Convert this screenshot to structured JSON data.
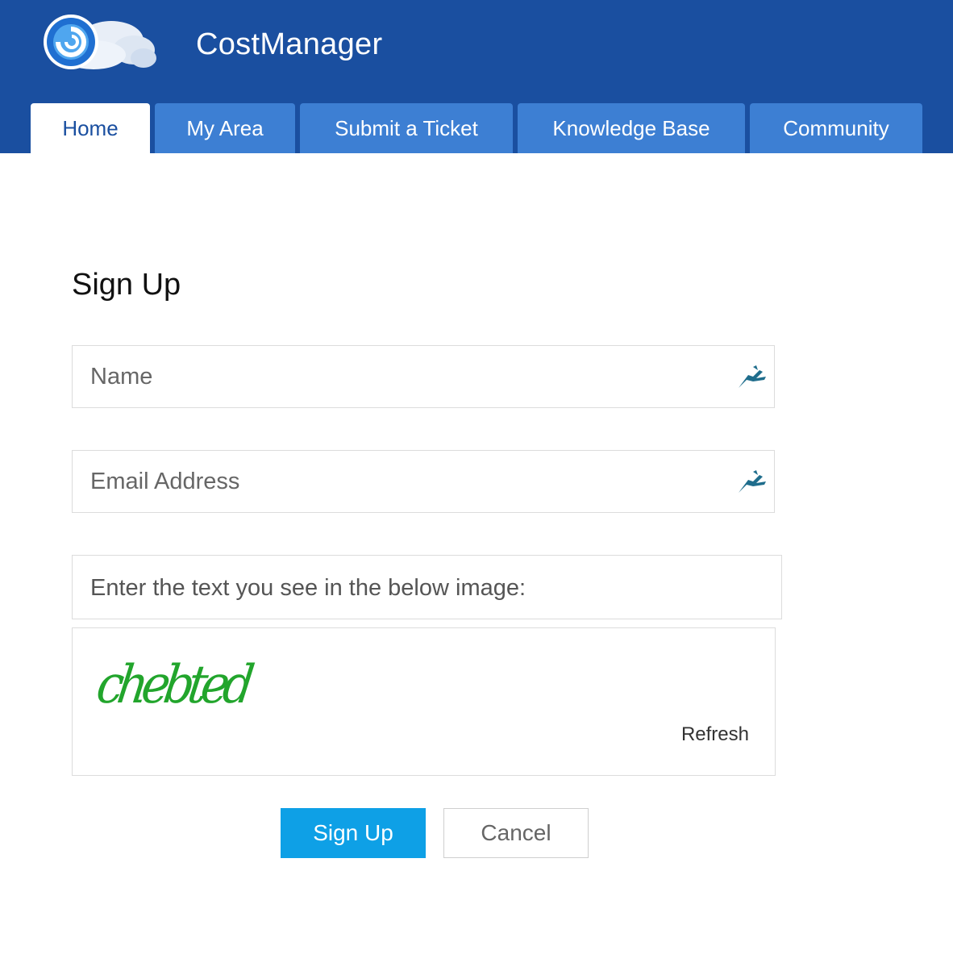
{
  "header": {
    "brand": "CostManager",
    "bg_color": "#1a4fa0",
    "logo_icon": "cloud-globe-logo-icon"
  },
  "tabs": [
    {
      "label": "Home",
      "active": true
    },
    {
      "label": "My Area",
      "active": false
    },
    {
      "label": "Submit a Ticket",
      "active": false
    },
    {
      "label": "Knowledge Base",
      "active": false
    },
    {
      "label": "Community",
      "active": false
    }
  ],
  "form": {
    "title": "Sign Up",
    "name_placeholder": "Name",
    "name_value": "",
    "email_placeholder": "Email Address",
    "email_value": "",
    "captcha_label": "Enter the text you see in the below image:",
    "captcha_text": "chebted",
    "refresh_label": "Refresh",
    "autofill_icon": "autofill-bird-icon"
  },
  "buttons": {
    "signup_label": "Sign Up",
    "cancel_label": "Cancel",
    "primary_color": "#0ea0e6"
  }
}
